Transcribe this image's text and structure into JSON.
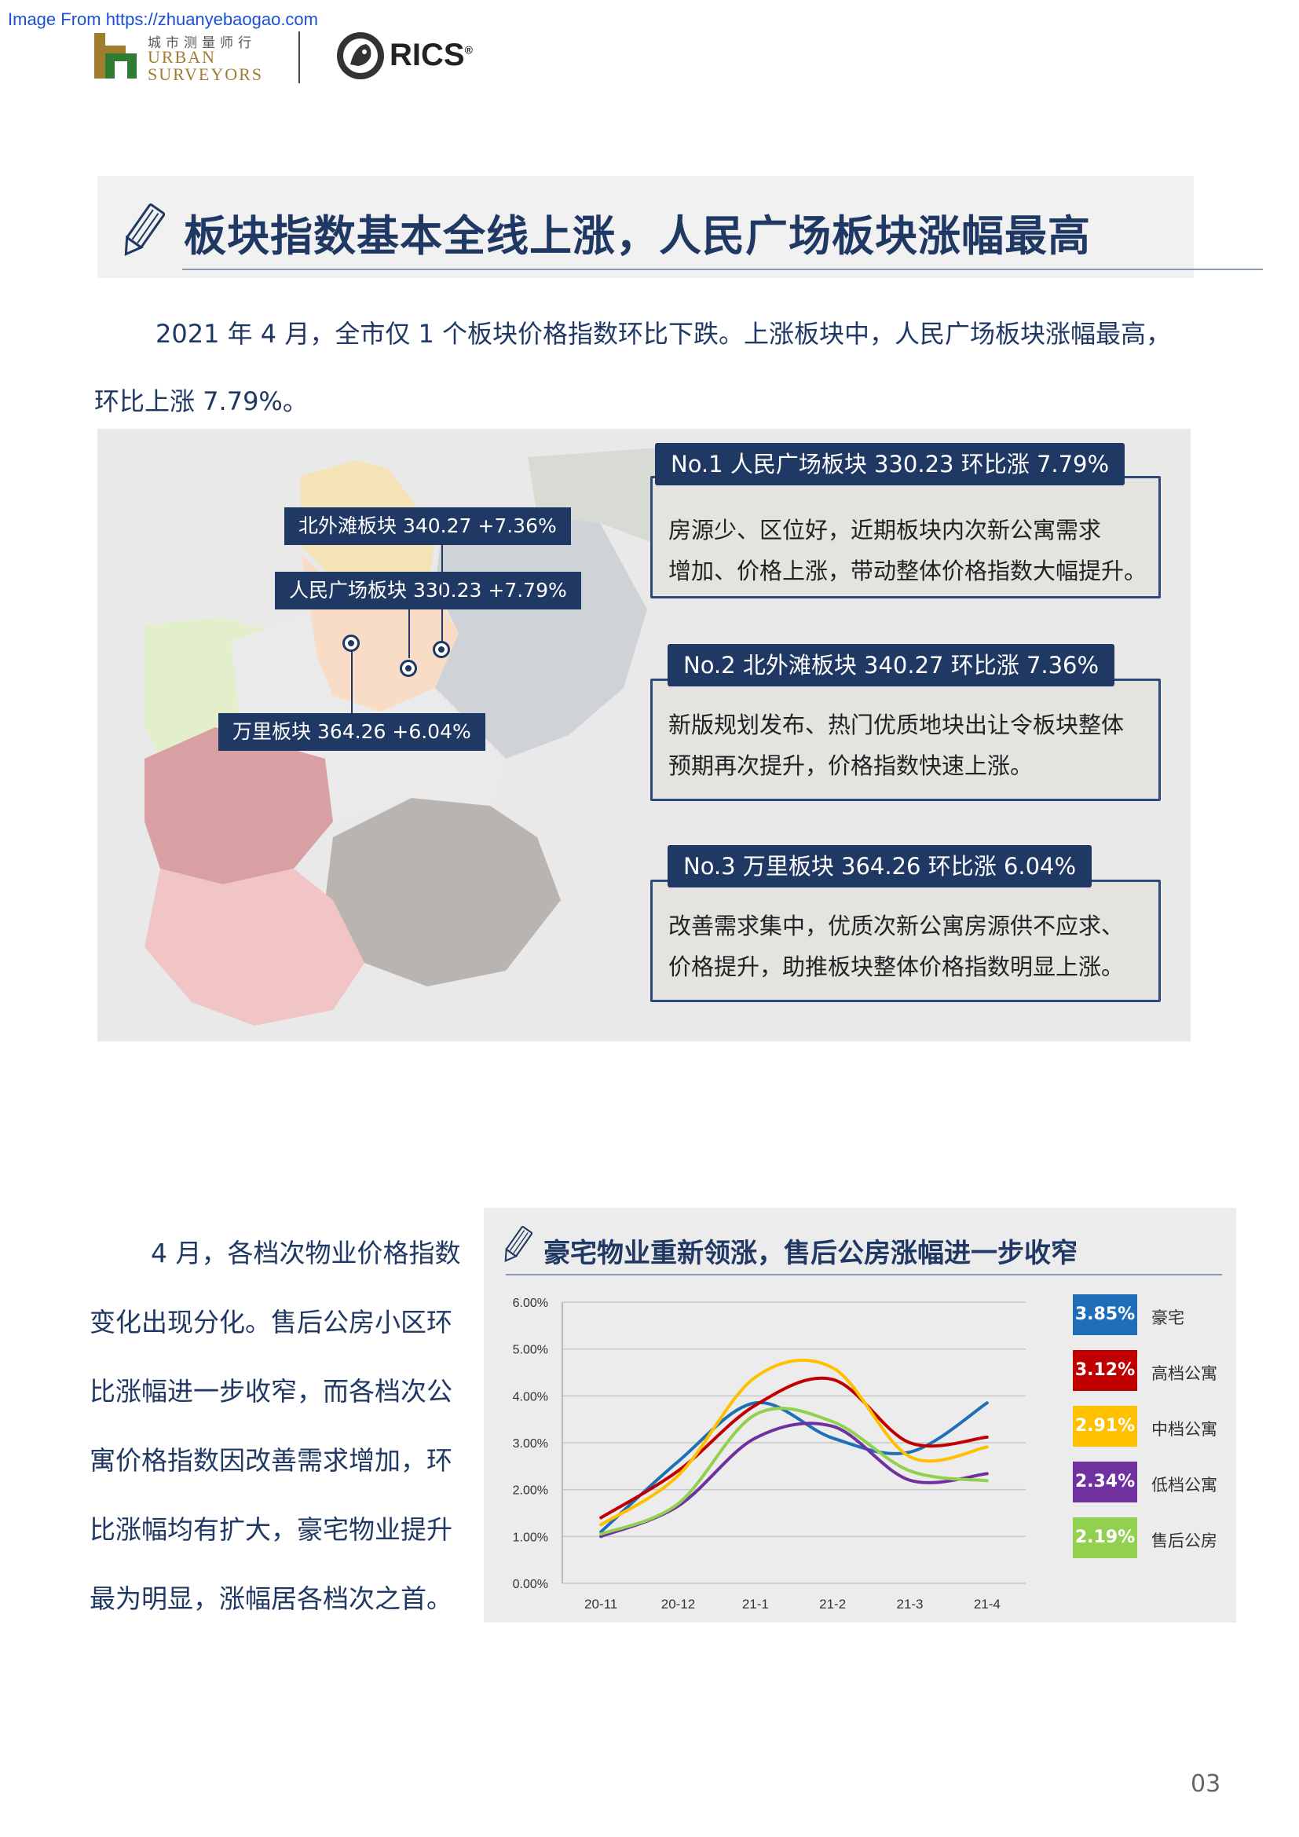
{
  "header": {
    "source_watermark": "Image From https://zhuanyebaogao.com",
    "logo_cn": "城市测量师行",
    "logo_en_line1": "URBAN",
    "logo_en_line2": "SURVEYORS",
    "rics": "RICS",
    "rics_mark": "®"
  },
  "section1": {
    "title": "板块指数基本全线上涨，人民广场板块涨幅最高",
    "paragraph_line1": "2021 年 4 月，全市仅 1 个板块价格指数环比下跌。上涨板块中，人民广场板块涨幅最高，",
    "paragraph_line2": "环比上涨 7.79%。"
  },
  "map": {
    "label_beiwaitan": "北外滩板块 340.27 +7.36%",
    "label_renmin": "人民广场板块 330.23 +7.79%",
    "label_wanli": "万里板块 364.26 +6.04%",
    "region_colors": [
      "#f3e3b6",
      "#e3efca",
      "#cfd3d8",
      "#f8dcc6",
      "#d9a0a3",
      "#b9b4b0",
      "#f1c4c6",
      "#eaeaea",
      "#d7dbd4"
    ]
  },
  "cards": [
    {
      "head": "No.1  人民广场板块   330.23  环比涨 7.79%",
      "line1": "房源少、区位好，近期板块内次新公寓需求",
      "line2": "增加、价格上涨，带动整体价格指数大幅提升。"
    },
    {
      "head": "No.2 北外滩板块 340.27   环比涨 7.36%",
      "line1": "新版规划发布、热门优质地块出让令板块整体",
      "line2": "预期再次提升，价格指数快速上涨。"
    },
    {
      "head": "No.3 万里板块 364.26   环比涨 6.04%",
      "line1": "改善需求集中，优质次新公寓房源供不应求、",
      "line2": "价格提升，助推板块整体价格指数明显上涨。"
    }
  ],
  "section2": {
    "paragraph_lines": [
      "4 月，各档次物业价格指数",
      "变化出现分化。售后公房小区环",
      "比涨幅进一步收窄，而各档次公",
      "寓价格指数因改善需求增加，环",
      "比涨幅均有扩大，豪宅物业提升",
      "最为明显，涨幅居各档次之首。"
    ]
  },
  "chart_data": {
    "type": "line",
    "title": "豪宅物业重新领涨，售后公房涨幅进一步收窄",
    "categories": [
      "20-11",
      "20-12",
      "21-1",
      "21-2",
      "21-3",
      "21-4"
    ],
    "yticks": [
      "0.00%",
      "1.00%",
      "2.00%",
      "3.00%",
      "4.00%",
      "5.00%",
      "6.00%"
    ],
    "ylim": [
      0,
      6
    ],
    "grid": true,
    "series": [
      {
        "name": "豪宅",
        "label": "3.85%",
        "color": "#1e6fb8",
        "values": [
          1.1,
          2.6,
          3.85,
          3.1,
          2.8,
          3.85
        ]
      },
      {
        "name": "高档公寓",
        "label": "3.12%",
        "color": "#c00000",
        "values": [
          1.4,
          2.4,
          3.8,
          4.35,
          3.0,
          3.12
        ]
      },
      {
        "name": "中档公寓",
        "label": "2.91%",
        "color": "#ffc000",
        "values": [
          1.25,
          2.3,
          4.4,
          4.6,
          2.7,
          2.91
        ]
      },
      {
        "name": "低档公寓",
        "label": "2.34%",
        "color": "#7030a0",
        "values": [
          1.0,
          1.65,
          3.1,
          3.35,
          2.2,
          2.34
        ]
      },
      {
        "name": "售后公房",
        "label": "2.19%",
        "color": "#92d050",
        "values": [
          1.05,
          1.7,
          3.6,
          3.45,
          2.4,
          2.19
        ]
      }
    ]
  },
  "footer": {
    "page_number": "03"
  }
}
